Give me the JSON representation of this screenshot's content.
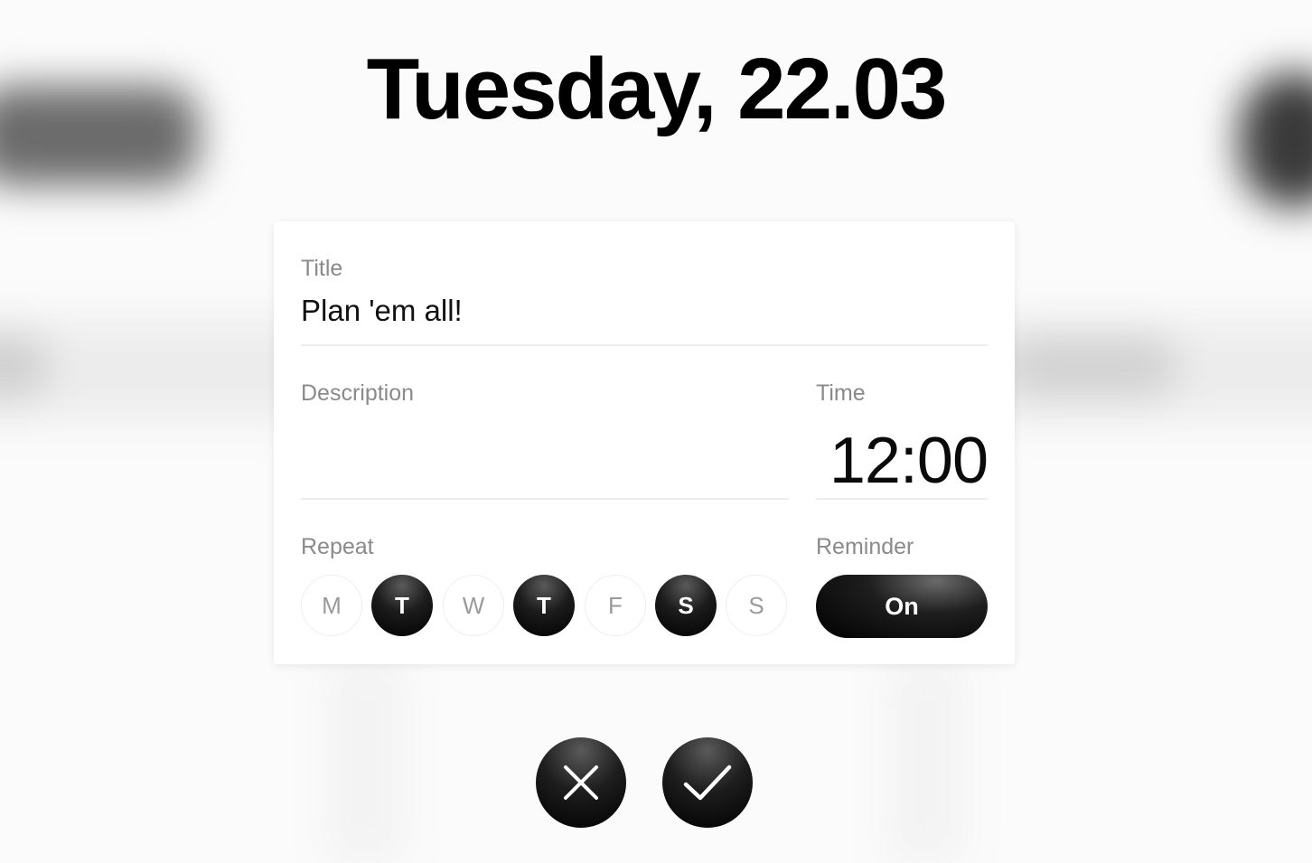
{
  "header": {
    "date_title": "Tuesday, 22.03"
  },
  "form": {
    "title": {
      "label": "Title",
      "value": "Plan 'em all!"
    },
    "description": {
      "label": "Description",
      "value": ""
    },
    "time": {
      "label": "Time",
      "value": "12:00"
    },
    "repeat": {
      "label": "Repeat",
      "days": [
        {
          "letter": "M",
          "selected": false
        },
        {
          "letter": "T",
          "selected": true
        },
        {
          "letter": "W",
          "selected": false
        },
        {
          "letter": "T",
          "selected": true
        },
        {
          "letter": "F",
          "selected": false
        },
        {
          "letter": "S",
          "selected": true
        },
        {
          "letter": "S",
          "selected": false
        }
      ]
    },
    "reminder": {
      "label": "Reminder",
      "state": "On"
    }
  },
  "actions": {
    "cancel_icon": "close-icon",
    "confirm_icon": "checkmark-icon"
  },
  "colors": {
    "accent": "#000000",
    "label": "#8a8a8a",
    "inactive_day_text": "#9a9a9a",
    "divider": "#ededed"
  }
}
